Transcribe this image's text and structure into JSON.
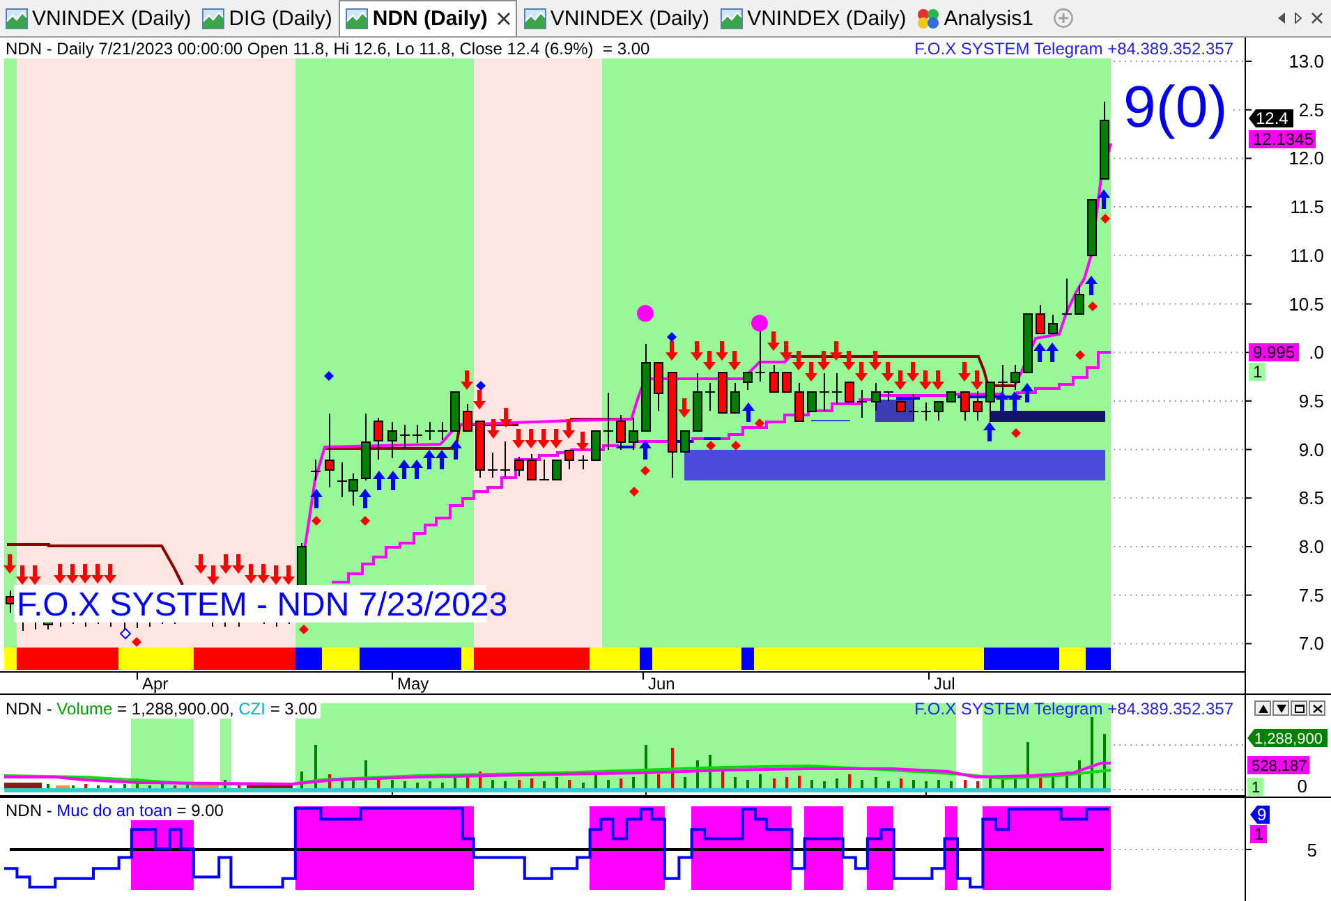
{
  "tabs": [
    {
      "label": "VNINDEX (Daily)",
      "kind": "chart",
      "selected": false
    },
    {
      "label": "DIG (Daily)",
      "kind": "chart",
      "selected": false
    },
    {
      "label": "NDN (Daily)",
      "kind": "chart",
      "selected": true
    },
    {
      "label": "VNINDEX (Daily)",
      "kind": "chart",
      "selected": false
    },
    {
      "label": "VNINDEX (Daily)",
      "kind": "chart",
      "selected": false
    },
    {
      "label": "Analysis1",
      "kind": "analysis",
      "selected": false
    }
  ],
  "price_pane": {
    "header": "NDN - Daily 7/21/2023 00:00:00 Open 11.8, Hi 12.6, Lo 11.8, Close 12.4 (6.9%)  = 3.00",
    "contact": "F.O.X SYSTEM Telegram +84.389.352.357",
    "signal_count": "9(0)",
    "title_banner": "F.O.X SYSTEM - NDN 7/23/2023",
    "y_ticks": [
      "13.0",
      "2.5",
      "12.0",
      "11.5",
      "11.0",
      "10.5",
      ".0",
      "9.5",
      "9.0",
      "8.5",
      "8.0",
      "7.5",
      "7.0"
    ],
    "x_labels": [
      "Apr",
      "May",
      "Jun",
      "Jul"
    ],
    "value_tags": [
      {
        "text": "12.4",
        "kind": "pointer",
        "color": "#000000"
      },
      {
        "text": "12.1345",
        "kind": "box",
        "color": "#ff00ff"
      },
      {
        "text": "9.995",
        "kind": "box",
        "color": "#ff00ff"
      },
      {
        "text": "1",
        "kind": "box",
        "color": "#99ff99"
      }
    ]
  },
  "volume_pane": {
    "header": {
      "symbol": "NDN -",
      "series": "Volume",
      "value": "= 1,288,900.00,",
      "indicator": "CZI",
      "indicator_value": "= 3.00"
    },
    "contact": "F.O.X SYSTEM Telegram +84.389.352.357",
    "y_ticks": [
      "0"
    ],
    "value_tags": [
      {
        "text": "1,288,900",
        "kind": "pointer",
        "color": "#008000"
      },
      {
        "text": "528,187",
        "kind": "box",
        "color": "#ff00ff"
      },
      {
        "text": "1",
        "kind": "box",
        "color": "#99ff99"
      }
    ]
  },
  "safety_pane": {
    "header": {
      "symbol": "NDN -",
      "series": "Muc do an toan",
      "value": "= 9.00"
    },
    "y_ticks": [
      "5"
    ],
    "value_tags": [
      {
        "text": "9",
        "kind": "pointer",
        "color": "#0000ff"
      },
      {
        "text": "1",
        "kind": "box",
        "color": "#ff00ff"
      }
    ]
  }
}
